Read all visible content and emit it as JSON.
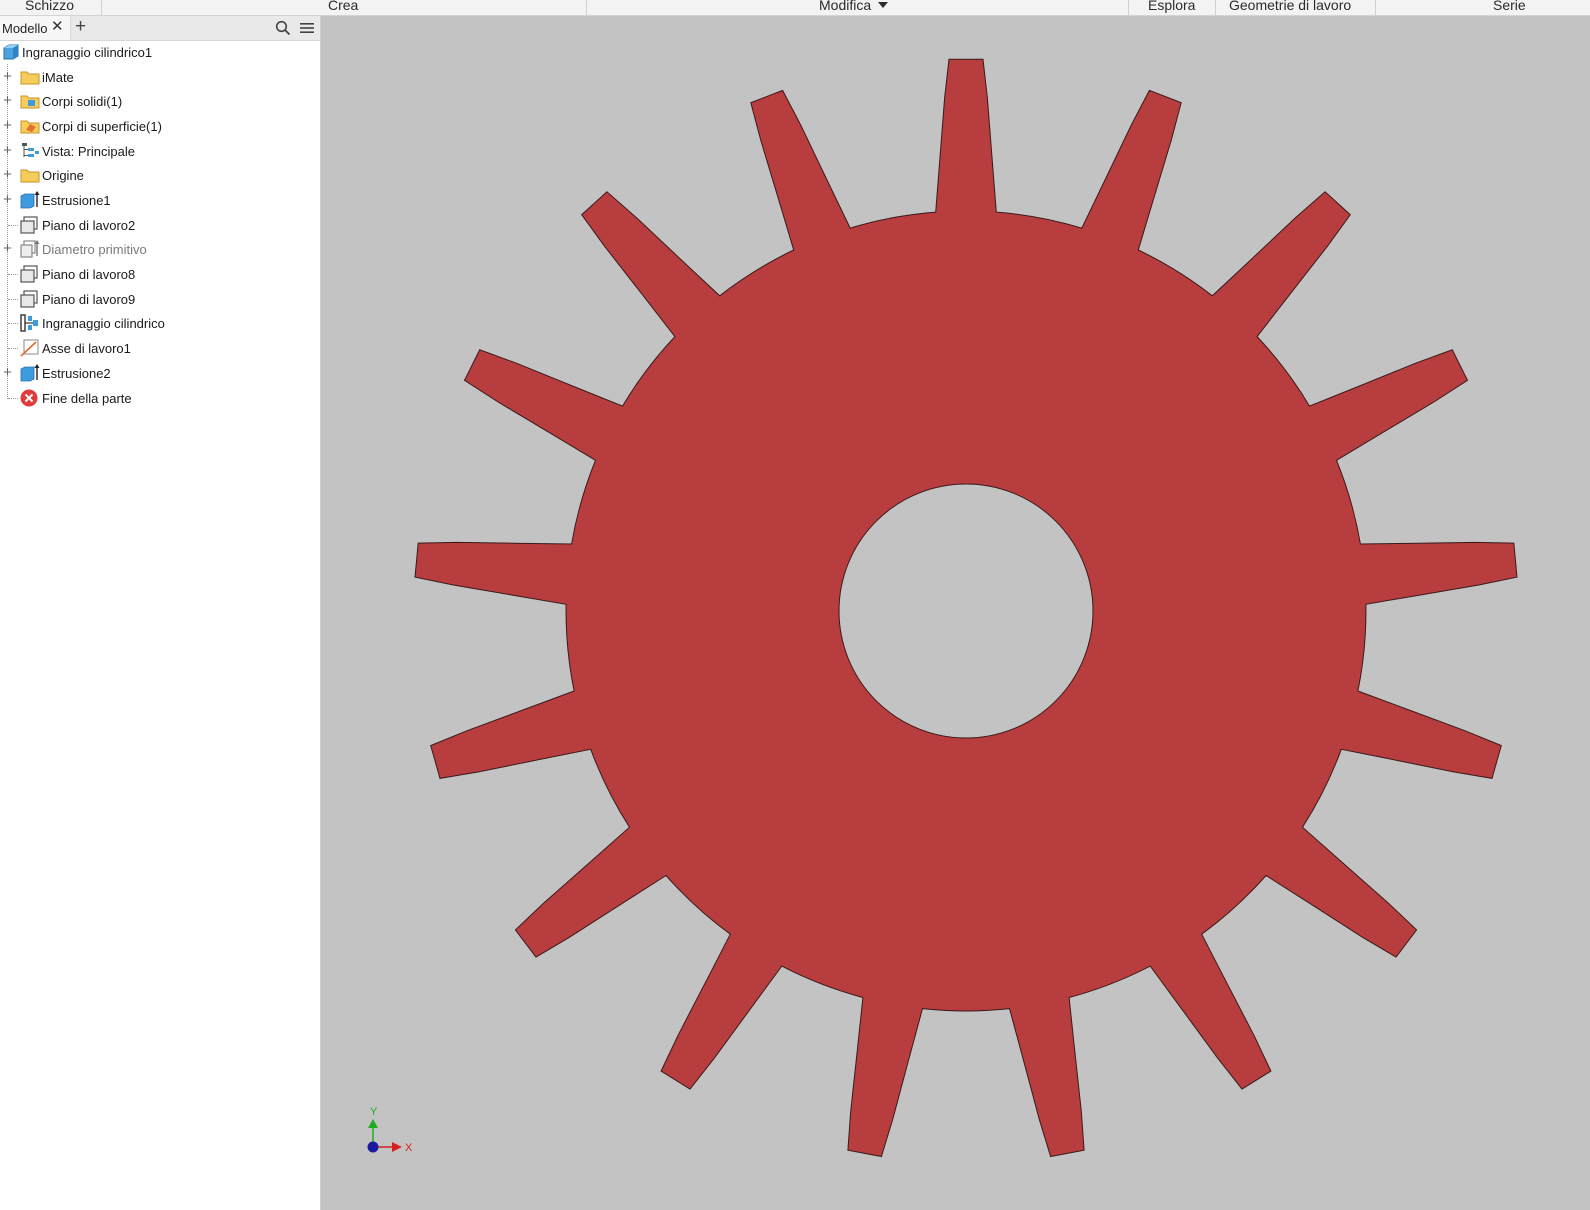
{
  "ribbon": {
    "tabs": [
      {
        "label": "Schizzo",
        "dropdown": false
      },
      {
        "label": "Crea",
        "dropdown": false
      },
      {
        "label": "Modifica",
        "dropdown": true
      },
      {
        "label": "Esplora",
        "dropdown": false
      },
      {
        "label": "Geometrie di lavoro",
        "dropdown": false
      },
      {
        "label": "Serie",
        "dropdown": false
      }
    ]
  },
  "browser": {
    "tab_label": "Modello",
    "close_icon": "close-icon",
    "add_icon": "plus-icon",
    "search_icon": "search-icon",
    "menu_icon": "hamburger-menu-icon",
    "root": {
      "label": "Ingranaggio cilindrico1",
      "icon": "part-icon"
    },
    "nodes": [
      {
        "label": "iMate",
        "icon": "folder-icon",
        "expandable": true,
        "dim": false
      },
      {
        "label": "Corpi solidi(1)",
        "icon": "solid-bodies-folder-icon",
        "expandable": true,
        "dim": false
      },
      {
        "label": "Corpi di superficie(1)",
        "icon": "surface-bodies-folder-icon",
        "expandable": true,
        "dim": false
      },
      {
        "label": "Vista: Principale",
        "icon": "view-representation-icon",
        "expandable": true,
        "dim": false
      },
      {
        "label": "Origine",
        "icon": "folder-icon",
        "expandable": true,
        "dim": false
      },
      {
        "label": "Estrusione1",
        "icon": "extrude-icon",
        "expandable": true,
        "dim": false
      },
      {
        "label": "Piano di lavoro2",
        "icon": "work-plane-icon",
        "expandable": false,
        "dim": false
      },
      {
        "label": "Diametro primitivo",
        "icon": "extrude-surface-icon",
        "expandable": true,
        "dim": true
      },
      {
        "label": "Piano di lavoro8",
        "icon": "work-plane-icon",
        "expandable": false,
        "dim": false
      },
      {
        "label": "Piano di lavoro9",
        "icon": "work-plane-icon",
        "expandable": false,
        "dim": false
      },
      {
        "label": "Ingranaggio cilindrico",
        "icon": "spur-gear-icon",
        "expandable": false,
        "dim": false
      },
      {
        "label": "Asse di lavoro1",
        "icon": "work-axis-icon",
        "expandable": false,
        "dim": false
      },
      {
        "label": "Estrusione2",
        "icon": "extrude-icon",
        "expandable": true,
        "dim": false
      },
      {
        "label": "Fine della parte",
        "icon": "end-of-part-icon",
        "expandable": false,
        "dim": false
      }
    ]
  },
  "viewport": {
    "background_color": "#c3c3c3",
    "gear": {
      "teeth": 17,
      "color": "#b83d3f",
      "edge_color": "#3a1a1a"
    },
    "triad": {
      "x_label": "X",
      "y_label": "Y",
      "x_color": "#d62020",
      "y_color": "#1fae1f",
      "origin_color": "#1a1aa0"
    }
  }
}
